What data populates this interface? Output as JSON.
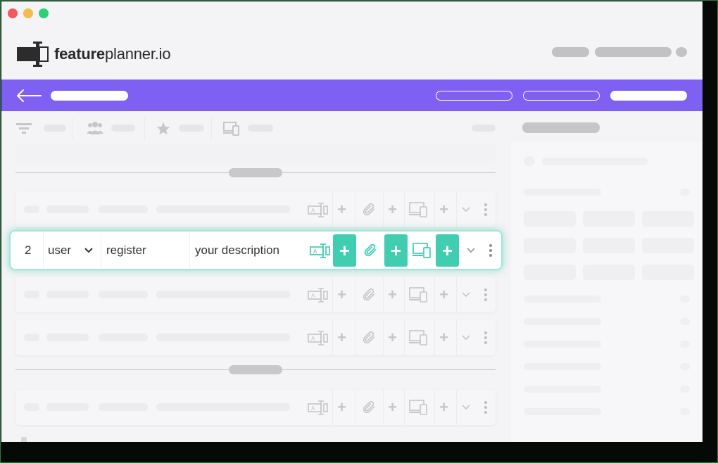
{
  "window": {
    "controls": [
      "close",
      "minimize",
      "maximize"
    ]
  },
  "brand": {
    "name_bold": "feature",
    "name_rest": "planner.io",
    "logo_icon": "feature-bar-icon"
  },
  "colors": {
    "accent": "#7e60f3",
    "teal": "#41ceb0",
    "teal_glow": "#9ee7d8"
  },
  "nav": {
    "back_icon": "arrow-left-icon"
  },
  "toolbar": {
    "icons": [
      "filter-icon",
      "users-icon",
      "star-icon",
      "devices-icon"
    ]
  },
  "feature_row": {
    "number": "2",
    "role": "user",
    "action": "register",
    "description": "your description",
    "icons": [
      "text-field-icon",
      "paperclip-icon",
      "devices-icon",
      "chevron-down-icon",
      "more-vertical-icon"
    ],
    "add_label": "+"
  },
  "faded_row_icons": {
    "add_label": "+"
  }
}
